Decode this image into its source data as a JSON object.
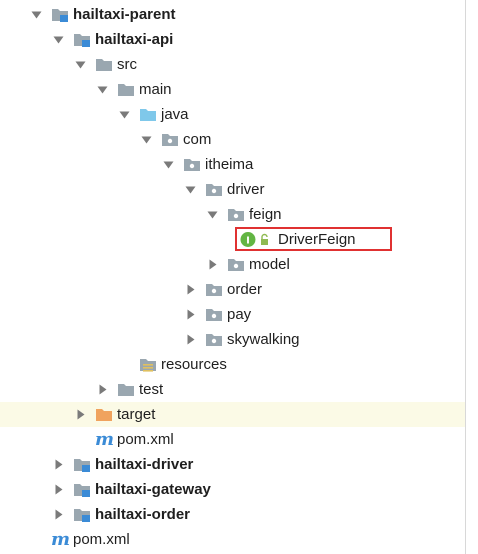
{
  "tree": {
    "nodes": [
      {
        "label": "hailtaxi-parent",
        "type": "module",
        "arrow": "expanded",
        "bold": true
      },
      {
        "label": "hailtaxi-api",
        "type": "module",
        "arrow": "expanded",
        "bold": true
      },
      {
        "label": "src",
        "type": "folder",
        "arrow": "expanded"
      },
      {
        "label": "main",
        "type": "folder",
        "arrow": "expanded"
      },
      {
        "label": "java",
        "type": "source-root",
        "arrow": "expanded"
      },
      {
        "label": "com",
        "type": "package",
        "arrow": "expanded"
      },
      {
        "label": "itheima",
        "type": "package",
        "arrow": "expanded"
      },
      {
        "label": "driver",
        "type": "package",
        "arrow": "expanded"
      },
      {
        "label": "feign",
        "type": "package",
        "arrow": "expanded"
      },
      {
        "label": "DriverFeign",
        "type": "interface",
        "arrow": "none",
        "selected": true
      },
      {
        "label": "model",
        "type": "package",
        "arrow": "collapsed"
      },
      {
        "label": "order",
        "type": "package",
        "arrow": "collapsed"
      },
      {
        "label": "pay",
        "type": "package",
        "arrow": "collapsed"
      },
      {
        "label": "skywalking",
        "type": "package",
        "arrow": "collapsed"
      },
      {
        "label": "resources",
        "type": "resources",
        "arrow": "none"
      },
      {
        "label": "test",
        "type": "folder",
        "arrow": "collapsed"
      },
      {
        "label": "target",
        "type": "excluded-folder",
        "arrow": "collapsed",
        "highlight": true
      },
      {
        "label": "pom.xml",
        "type": "maven",
        "arrow": "none"
      },
      {
        "label": "hailtaxi-driver",
        "type": "module",
        "arrow": "collapsed",
        "bold": true
      },
      {
        "label": "hailtaxi-gateway",
        "type": "module",
        "arrow": "collapsed",
        "bold": true
      },
      {
        "label": "hailtaxi-order",
        "type": "module",
        "arrow": "collapsed",
        "bold": true
      },
      {
        "label": "pom.xml",
        "type": "maven",
        "arrow": "none"
      }
    ]
  },
  "colors": {
    "folder": "#9aa7b0",
    "source_root": "#7fc8ea",
    "excluded_folder": "#f0a35e",
    "module_marker": "#3b8bd6",
    "interface_badge": "#62b543",
    "maven": "#3b8bd6",
    "selection_border": "#e03131",
    "row_highlight": "#fbfae6"
  }
}
